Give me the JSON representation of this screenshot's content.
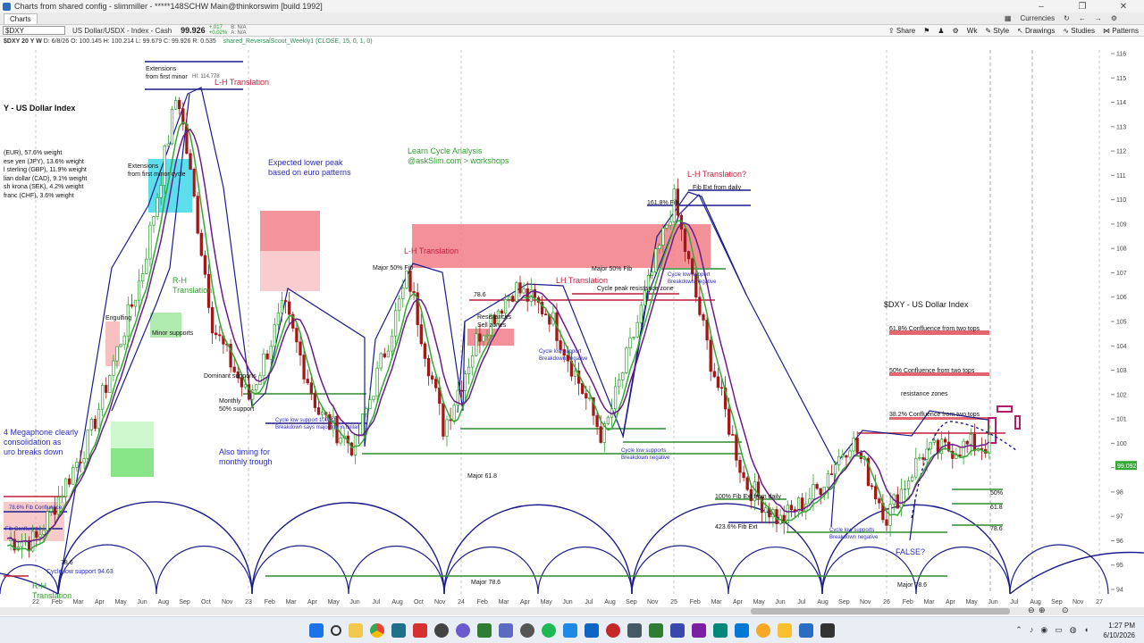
{
  "window": {
    "title": "Charts from shared config - slimmiller - *****148SCHW Main@thinkorswim [build 1992]",
    "minimize": "–",
    "maximize": "❐",
    "close": "✕"
  },
  "tabs": [
    {
      "label": "Charts"
    }
  ],
  "topbar": {
    "currencies": "Currencies"
  },
  "toolbar": {
    "symbol": "$DXY",
    "description": "US Dollar/USDX - Index - Cash",
    "last": "99.926",
    "change_line1": "+.017",
    "change_line2": "+0.02%",
    "bid_line1": "B: N/A",
    "bid_line2": "A: N/A",
    "share": "Share",
    "timeframe": "Wk",
    "style": "Style",
    "drawings": "Drawings",
    "studies": "Studies",
    "patterns": "Patterns"
  },
  "infobar": {
    "header": "$DXY 20 Y W",
    "ohlc": "D: 6/8/26   O: 100.145   H: 100.214   L: 99.679   C: 99.926   R: 0.535",
    "study": "shared_ReversalScout_Weekly1 (CLOSE, 15, 0, 1, 0)"
  },
  "chart_data": {
    "type": "candlestick",
    "title": "$DXY - US Dollar Index",
    "y_range": [
      94,
      116
    ],
    "y_ticks": [
      "116",
      "115",
      "114",
      "113",
      "112",
      "111",
      "110",
      "109",
      "108",
      "107",
      "106",
      "105",
      "104",
      "103",
      "102",
      "101",
      "100",
      "99",
      "98",
      "97",
      "96",
      "95",
      "94"
    ],
    "last_price_label": "99.092",
    "x_ticks": [
      "22",
      "Feb",
      "Mar",
      "Apr",
      "May",
      "Jun",
      "Aug",
      "Sep",
      "Oct",
      "Nov",
      "23",
      "Feb",
      "Mar",
      "Apr",
      "May",
      "Jun",
      "Jul",
      "Aug",
      "Oct",
      "Nov",
      "24",
      "Feb",
      "Mar",
      "Apr",
      "May",
      "Jun",
      "Jul",
      "Aug",
      "Sep",
      "Nov",
      "25",
      "Feb",
      "Mar",
      "Apr",
      "May",
      "Jun",
      "Jul",
      "Aug",
      "Sep",
      "Nov",
      "26",
      "Feb",
      "Mar",
      "Apr",
      "May",
      "Jun",
      "Jul",
      "Aug",
      "Sep",
      "Nov",
      "27"
    ],
    "price_path": [
      [
        "2022-01",
        96.0
      ],
      [
        "2022-04",
        100.2
      ],
      [
        "2022-07",
        107.0
      ],
      [
        "2022-09",
        114.5
      ],
      [
        "2022-11",
        104.8
      ],
      [
        "2023-01",
        101.8
      ],
      [
        "2023-03",
        105.6
      ],
      [
        "2023-05",
        101.2
      ],
      [
        "2023-07",
        99.8
      ],
      [
        "2023-10",
        106.9
      ],
      [
        "2023-12",
        100.6
      ],
      [
        "2024-02",
        104.5
      ],
      [
        "2024-04",
        106.4
      ],
      [
        "2024-06",
        105.3
      ],
      [
        "2024-09",
        100.2
      ],
      [
        "2025-01",
        110.0
      ],
      [
        "2025-03",
        103.6
      ],
      [
        "2025-05",
        98.4
      ],
      [
        "2025-07",
        96.8
      ],
      [
        "2025-09",
        98.0
      ],
      [
        "2025-11",
        100.2
      ],
      [
        "2026-01",
        97.0
      ],
      [
        "2026-03",
        99.6
      ],
      [
        "2026-06",
        99.93
      ]
    ],
    "text_annotations": [
      "Extensions\nfrom first minor",
      "HI: 114.778",
      "L-H Translation",
      "Y - US Dollar Index",
      "(EUR), 57.6% weight",
      "ese yen (JPY), 13.6% weight",
      "l sterling (GBP), 11.9% weight",
      "lian dollar (CAD), 9.1% weight",
      "sh krona (SEK), 4.2% weight",
      "franc (CHF), 3.6% weight",
      "Extensions\nfrom first minor cycle",
      "Expected lower peak\nbased on euro patterns",
      "Learn Cycle Analysis\n@askSlim.com > workshops",
      "L-H Translation?",
      "Fib Ext from daily",
      "161.8% Fib",
      "L-H Translation",
      "Major 50% Fib",
      "Major 50% Fib",
      "LH Translation",
      "Cycle peak resistance zone",
      "78.6",
      "Resistances\nSell zones",
      "Cycle low support\nBreakdown negative",
      "Cycle low support\nBreakdown negative",
      "R-H\nTranslation",
      "Engulfing",
      "Minor supports",
      "Dominant supports",
      "Monthly\n50% support",
      "Cycle low support 100.82\nBreakdown says major top in dollar",
      "Also timing for\nmonthly trough",
      "4  Megaphone clearly\nconsolidation as\nuro breaks down",
      "Major 61.8",
      "Cycle low supports\nBreakdown negative",
      "100% Fib Ext from daily",
      "423.6% Fib Ext",
      "Cycle low supports\nBreakdown negative",
      "FALSE?",
      "Major 78.6",
      "Major 78.6",
      "$DXY - US Dollar Index",
      "61.8% Confluence from two tops",
      "50% Confluence from two tops",
      "resistance zones",
      "38.2% Confluence from two tops",
      "50%",
      "61.8",
      "78.6",
      "78.6% Fib Confluence",
      "Fib Confluence",
      "78.6",
      "Cycle low support 94.63",
      "R-H\nTranslation"
    ]
  },
  "taskbar": {
    "time": "1:27 PM",
    "date": "6/10/2026"
  }
}
